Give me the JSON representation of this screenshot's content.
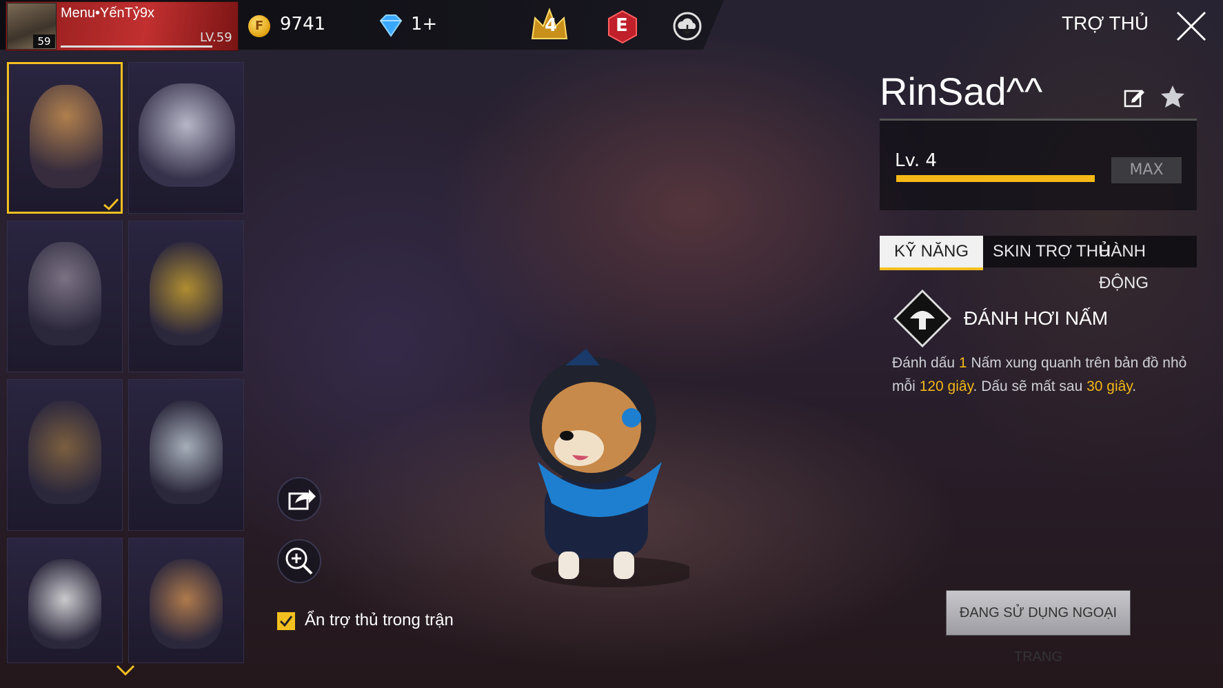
{
  "header": {
    "player_name": "Menu•YếnTỷ9x",
    "avatar_level": "59",
    "player_level": "LV.59",
    "gold": "9741",
    "diamonds": "1+",
    "rank_badge": "4",
    "elite_badge": "E",
    "section_title": "TRỢ THỦ"
  },
  "pet": {
    "name": "RinSad^^",
    "level": "Lv. 4",
    "level_progress": 1.0,
    "max_label": "MAX"
  },
  "tabs": [
    "KỸ NĂNG",
    "SKIN TRỢ THỦ",
    "HÀNH ĐỘNG"
  ],
  "skill": {
    "name": "ĐÁNH HƠI NẤM",
    "desc_1": "Đánh dấu ",
    "desc_num": "1",
    "desc_2": " Nấm xung quanh trên bản đồ nhỏ mỗi ",
    "desc_time1": "120 giây",
    "desc_3": ". Dấu sẽ mất sau ",
    "desc_time2": "30 giây",
    "desc_4": "."
  },
  "controls": {
    "hide_label": "Ẩn trợ thủ trong trận",
    "hide_checked": true,
    "use_button": "ĐANG SỬ DỤNG NGOẠI TRANG"
  },
  "pets_grid": [
    {
      "name": "shiba-pet-card",
      "selected": true
    },
    {
      "name": "wolf-pet-card",
      "selected": false
    },
    {
      "name": "raccoon-pet-card",
      "selected": false
    },
    {
      "name": "penguin-pet-card",
      "selected": false
    },
    {
      "name": "falcon-pet-card",
      "selected": false
    },
    {
      "name": "robot-pet-card",
      "selected": false
    },
    {
      "name": "panda-pet-card",
      "selected": false
    },
    {
      "name": "cat-pet-card",
      "selected": false
    }
  ],
  "colors": {
    "accent": "#f4c020",
    "progress": "#f4b818",
    "highlight": "#f4b818"
  }
}
